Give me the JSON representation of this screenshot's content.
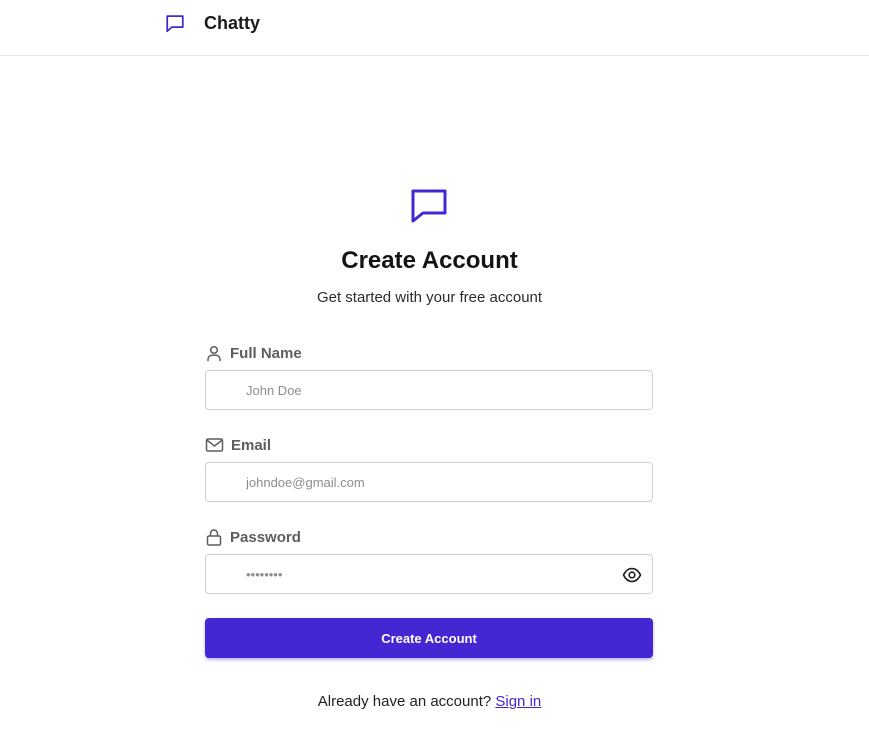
{
  "app": {
    "name": "Chatty",
    "logo_icon": "message-square-icon"
  },
  "colors": {
    "accent": "#4427d3",
    "label": "#5d5d62",
    "border": "#cfcfd4"
  },
  "form": {
    "icon": "message-square-icon",
    "title": "Create Account",
    "subtitle": "Get started with your free account",
    "fields": {
      "full_name": {
        "icon": "user-icon",
        "label": "Full Name",
        "placeholder": "John Doe",
        "value": ""
      },
      "email": {
        "icon": "mail-icon",
        "label": "Email",
        "placeholder": "johndoe@gmail.com",
        "value": ""
      },
      "password": {
        "icon": "lock-icon",
        "label": "Password",
        "placeholder": "••••••••",
        "value": "",
        "toggle_icon": "eye-icon"
      }
    },
    "submit_label": "Create Account",
    "signin_prompt": "Already have an account?",
    "signin_link": "Sign in"
  }
}
